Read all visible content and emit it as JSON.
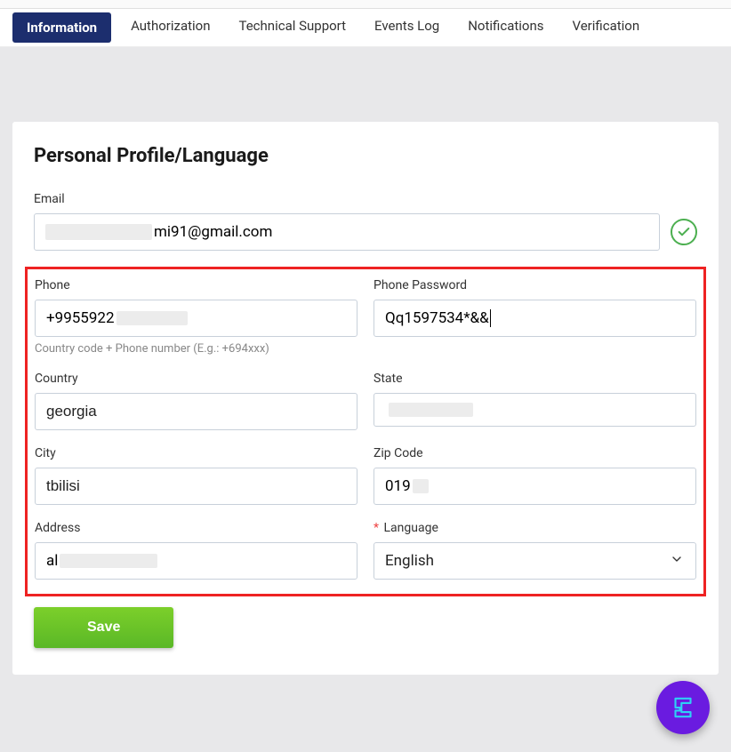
{
  "tabs": {
    "information": "Information",
    "authorization": "Authorization",
    "technical_support": "Technical Support",
    "events_log": "Events Log",
    "notifications": "Notifications",
    "verification": "Verification"
  },
  "page": {
    "title": "Personal Profile/Language"
  },
  "labels": {
    "email": "Email",
    "phone": "Phone",
    "phone_password": "Phone Password",
    "phone_hint": "Country code + Phone number (E.g.: +694xxx)",
    "country": "Country",
    "state": "State",
    "city": "City",
    "zip": "Zip Code",
    "address": "Address",
    "language": "Language",
    "required_marker": "*"
  },
  "values": {
    "email_suffix": "mi91@gmail.com",
    "phone_prefix": "+9955922",
    "phone_password": "Qq1597534*&&",
    "country": "georgia",
    "city": "tbilisi",
    "zip_prefix": "019",
    "address_prefix": "al",
    "language": "English"
  },
  "buttons": {
    "save": "Save"
  }
}
